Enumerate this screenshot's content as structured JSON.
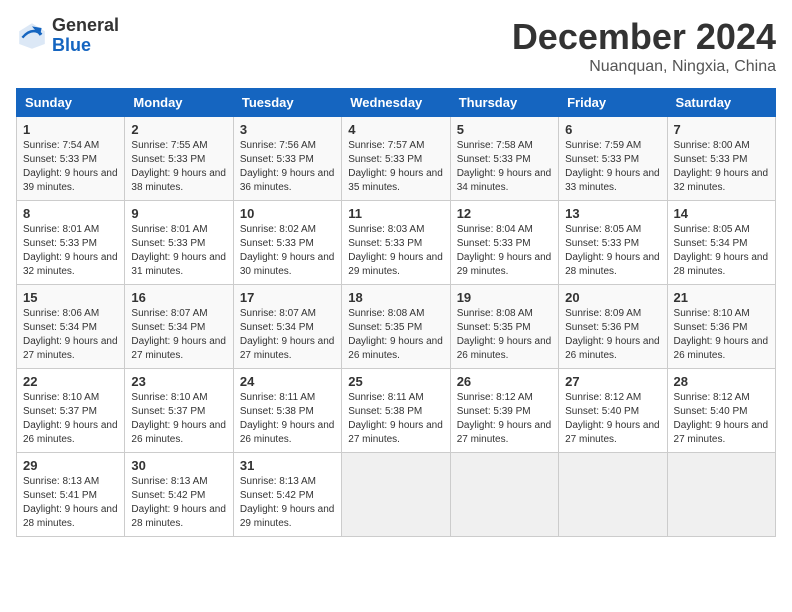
{
  "logo": {
    "general": "General",
    "blue": "Blue"
  },
  "title": {
    "month": "December 2024",
    "location": "Nuanquan, Ningxia, China"
  },
  "weekdays": [
    "Sunday",
    "Monday",
    "Tuesday",
    "Wednesday",
    "Thursday",
    "Friday",
    "Saturday"
  ],
  "weeks": [
    [
      {
        "day": "1",
        "sunrise": "7:54 AM",
        "sunset": "5:33 PM",
        "daylight": "9 hours and 39 minutes."
      },
      {
        "day": "2",
        "sunrise": "7:55 AM",
        "sunset": "5:33 PM",
        "daylight": "9 hours and 38 minutes."
      },
      {
        "day": "3",
        "sunrise": "7:56 AM",
        "sunset": "5:33 PM",
        "daylight": "9 hours and 36 minutes."
      },
      {
        "day": "4",
        "sunrise": "7:57 AM",
        "sunset": "5:33 PM",
        "daylight": "9 hours and 35 minutes."
      },
      {
        "day": "5",
        "sunrise": "7:58 AM",
        "sunset": "5:33 PM",
        "daylight": "9 hours and 34 minutes."
      },
      {
        "day": "6",
        "sunrise": "7:59 AM",
        "sunset": "5:33 PM",
        "daylight": "9 hours and 33 minutes."
      },
      {
        "day": "7",
        "sunrise": "8:00 AM",
        "sunset": "5:33 PM",
        "daylight": "9 hours and 32 minutes."
      }
    ],
    [
      {
        "day": "8",
        "sunrise": "8:01 AM",
        "sunset": "5:33 PM",
        "daylight": "9 hours and 32 minutes."
      },
      {
        "day": "9",
        "sunrise": "8:01 AM",
        "sunset": "5:33 PM",
        "daylight": "9 hours and 31 minutes."
      },
      {
        "day": "10",
        "sunrise": "8:02 AM",
        "sunset": "5:33 PM",
        "daylight": "9 hours and 30 minutes."
      },
      {
        "day": "11",
        "sunrise": "8:03 AM",
        "sunset": "5:33 PM",
        "daylight": "9 hours and 29 minutes."
      },
      {
        "day": "12",
        "sunrise": "8:04 AM",
        "sunset": "5:33 PM",
        "daylight": "9 hours and 29 minutes."
      },
      {
        "day": "13",
        "sunrise": "8:05 AM",
        "sunset": "5:33 PM",
        "daylight": "9 hours and 28 minutes."
      },
      {
        "day": "14",
        "sunrise": "8:05 AM",
        "sunset": "5:34 PM",
        "daylight": "9 hours and 28 minutes."
      }
    ],
    [
      {
        "day": "15",
        "sunrise": "8:06 AM",
        "sunset": "5:34 PM",
        "daylight": "9 hours and 27 minutes."
      },
      {
        "day": "16",
        "sunrise": "8:07 AM",
        "sunset": "5:34 PM",
        "daylight": "9 hours and 27 minutes."
      },
      {
        "day": "17",
        "sunrise": "8:07 AM",
        "sunset": "5:34 PM",
        "daylight": "9 hours and 27 minutes."
      },
      {
        "day": "18",
        "sunrise": "8:08 AM",
        "sunset": "5:35 PM",
        "daylight": "9 hours and 26 minutes."
      },
      {
        "day": "19",
        "sunrise": "8:08 AM",
        "sunset": "5:35 PM",
        "daylight": "9 hours and 26 minutes."
      },
      {
        "day": "20",
        "sunrise": "8:09 AM",
        "sunset": "5:36 PM",
        "daylight": "9 hours and 26 minutes."
      },
      {
        "day": "21",
        "sunrise": "8:10 AM",
        "sunset": "5:36 PM",
        "daylight": "9 hours and 26 minutes."
      }
    ],
    [
      {
        "day": "22",
        "sunrise": "8:10 AM",
        "sunset": "5:37 PM",
        "daylight": "9 hours and 26 minutes."
      },
      {
        "day": "23",
        "sunrise": "8:10 AM",
        "sunset": "5:37 PM",
        "daylight": "9 hours and 26 minutes."
      },
      {
        "day": "24",
        "sunrise": "8:11 AM",
        "sunset": "5:38 PM",
        "daylight": "9 hours and 26 minutes."
      },
      {
        "day": "25",
        "sunrise": "8:11 AM",
        "sunset": "5:38 PM",
        "daylight": "9 hours and 27 minutes."
      },
      {
        "day": "26",
        "sunrise": "8:12 AM",
        "sunset": "5:39 PM",
        "daylight": "9 hours and 27 minutes."
      },
      {
        "day": "27",
        "sunrise": "8:12 AM",
        "sunset": "5:40 PM",
        "daylight": "9 hours and 27 minutes."
      },
      {
        "day": "28",
        "sunrise": "8:12 AM",
        "sunset": "5:40 PM",
        "daylight": "9 hours and 27 minutes."
      }
    ],
    [
      {
        "day": "29",
        "sunrise": "8:13 AM",
        "sunset": "5:41 PM",
        "daylight": "9 hours and 28 minutes."
      },
      {
        "day": "30",
        "sunrise": "8:13 AM",
        "sunset": "5:42 PM",
        "daylight": "9 hours and 28 minutes."
      },
      {
        "day": "31",
        "sunrise": "8:13 AM",
        "sunset": "5:42 PM",
        "daylight": "9 hours and 29 minutes."
      },
      null,
      null,
      null,
      null
    ]
  ],
  "labels": {
    "sunrise": "Sunrise:",
    "sunset": "Sunset:",
    "daylight": "Daylight:"
  }
}
